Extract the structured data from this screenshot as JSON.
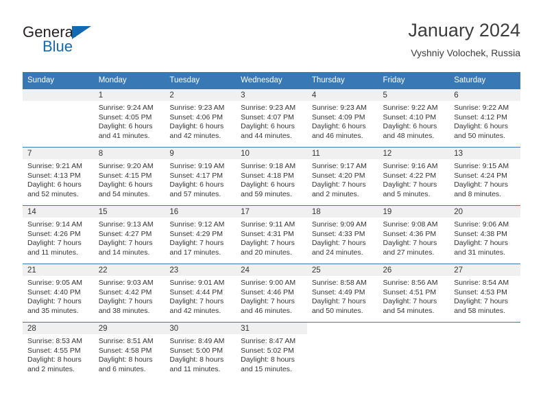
{
  "brand": {
    "name_part1": "General",
    "name_part2": "Blue",
    "accent_color": "#1268b3",
    "triangle_icon": "triangle-icon"
  },
  "header": {
    "title": "January 2024",
    "subtitle": "Vyshniy Volochek, Russia"
  },
  "calendar": {
    "header_bg": "#3878b4",
    "daynum_bg": "#f0f0f0",
    "weekday_headers": [
      "Sunday",
      "Monday",
      "Tuesday",
      "Wednesday",
      "Thursday",
      "Friday",
      "Saturday"
    ],
    "weeks": [
      [
        {
          "day": "",
          "empty": true,
          "sunrise": "",
          "sunset": "",
          "daylight_line1": "",
          "daylight_line2": ""
        },
        {
          "day": "1",
          "sunrise": "Sunrise: 9:24 AM",
          "sunset": "Sunset: 4:05 PM",
          "daylight_line1": "Daylight: 6 hours",
          "daylight_line2": "and 41 minutes."
        },
        {
          "day": "2",
          "sunrise": "Sunrise: 9:23 AM",
          "sunset": "Sunset: 4:06 PM",
          "daylight_line1": "Daylight: 6 hours",
          "daylight_line2": "and 42 minutes."
        },
        {
          "day": "3",
          "sunrise": "Sunrise: 9:23 AM",
          "sunset": "Sunset: 4:07 PM",
          "daylight_line1": "Daylight: 6 hours",
          "daylight_line2": "and 44 minutes."
        },
        {
          "day": "4",
          "sunrise": "Sunrise: 9:23 AM",
          "sunset": "Sunset: 4:09 PM",
          "daylight_line1": "Daylight: 6 hours",
          "daylight_line2": "and 46 minutes."
        },
        {
          "day": "5",
          "sunrise": "Sunrise: 9:22 AM",
          "sunset": "Sunset: 4:10 PM",
          "daylight_line1": "Daylight: 6 hours",
          "daylight_line2": "and 48 minutes."
        },
        {
          "day": "6",
          "sunrise": "Sunrise: 9:22 AM",
          "sunset": "Sunset: 4:12 PM",
          "daylight_line1": "Daylight: 6 hours",
          "daylight_line2": "and 50 minutes."
        }
      ],
      [
        {
          "day": "7",
          "sunrise": "Sunrise: 9:21 AM",
          "sunset": "Sunset: 4:13 PM",
          "daylight_line1": "Daylight: 6 hours",
          "daylight_line2": "and 52 minutes."
        },
        {
          "day": "8",
          "sunrise": "Sunrise: 9:20 AM",
          "sunset": "Sunset: 4:15 PM",
          "daylight_line1": "Daylight: 6 hours",
          "daylight_line2": "and 54 minutes."
        },
        {
          "day": "9",
          "sunrise": "Sunrise: 9:19 AM",
          "sunset": "Sunset: 4:17 PM",
          "daylight_line1": "Daylight: 6 hours",
          "daylight_line2": "and 57 minutes."
        },
        {
          "day": "10",
          "sunrise": "Sunrise: 9:18 AM",
          "sunset": "Sunset: 4:18 PM",
          "daylight_line1": "Daylight: 6 hours",
          "daylight_line2": "and 59 minutes."
        },
        {
          "day": "11",
          "sunrise": "Sunrise: 9:17 AM",
          "sunset": "Sunset: 4:20 PM",
          "daylight_line1": "Daylight: 7 hours",
          "daylight_line2": "and 2 minutes."
        },
        {
          "day": "12",
          "sunrise": "Sunrise: 9:16 AM",
          "sunset": "Sunset: 4:22 PM",
          "daylight_line1": "Daylight: 7 hours",
          "daylight_line2": "and 5 minutes."
        },
        {
          "day": "13",
          "sunrise": "Sunrise: 9:15 AM",
          "sunset": "Sunset: 4:24 PM",
          "daylight_line1": "Daylight: 7 hours",
          "daylight_line2": "and 8 minutes."
        }
      ],
      [
        {
          "day": "14",
          "sunrise": "Sunrise: 9:14 AM",
          "sunset": "Sunset: 4:26 PM",
          "daylight_line1": "Daylight: 7 hours",
          "daylight_line2": "and 11 minutes."
        },
        {
          "day": "15",
          "sunrise": "Sunrise: 9:13 AM",
          "sunset": "Sunset: 4:27 PM",
          "daylight_line1": "Daylight: 7 hours",
          "daylight_line2": "and 14 minutes."
        },
        {
          "day": "16",
          "sunrise": "Sunrise: 9:12 AM",
          "sunset": "Sunset: 4:29 PM",
          "daylight_line1": "Daylight: 7 hours",
          "daylight_line2": "and 17 minutes."
        },
        {
          "day": "17",
          "sunrise": "Sunrise: 9:11 AM",
          "sunset": "Sunset: 4:31 PM",
          "daylight_line1": "Daylight: 7 hours",
          "daylight_line2": "and 20 minutes."
        },
        {
          "day": "18",
          "sunrise": "Sunrise: 9:09 AM",
          "sunset": "Sunset: 4:33 PM",
          "daylight_line1": "Daylight: 7 hours",
          "daylight_line2": "and 24 minutes."
        },
        {
          "day": "19",
          "sunrise": "Sunrise: 9:08 AM",
          "sunset": "Sunset: 4:36 PM",
          "daylight_line1": "Daylight: 7 hours",
          "daylight_line2": "and 27 minutes."
        },
        {
          "day": "20",
          "sunrise": "Sunrise: 9:06 AM",
          "sunset": "Sunset: 4:38 PM",
          "daylight_line1": "Daylight: 7 hours",
          "daylight_line2": "and 31 minutes."
        }
      ],
      [
        {
          "day": "21",
          "sunrise": "Sunrise: 9:05 AM",
          "sunset": "Sunset: 4:40 PM",
          "daylight_line1": "Daylight: 7 hours",
          "daylight_line2": "and 35 minutes."
        },
        {
          "day": "22",
          "sunrise": "Sunrise: 9:03 AM",
          "sunset": "Sunset: 4:42 PM",
          "daylight_line1": "Daylight: 7 hours",
          "daylight_line2": "and 38 minutes."
        },
        {
          "day": "23",
          "sunrise": "Sunrise: 9:01 AM",
          "sunset": "Sunset: 4:44 PM",
          "daylight_line1": "Daylight: 7 hours",
          "daylight_line2": "and 42 minutes."
        },
        {
          "day": "24",
          "sunrise": "Sunrise: 9:00 AM",
          "sunset": "Sunset: 4:46 PM",
          "daylight_line1": "Daylight: 7 hours",
          "daylight_line2": "and 46 minutes."
        },
        {
          "day": "25",
          "sunrise": "Sunrise: 8:58 AM",
          "sunset": "Sunset: 4:49 PM",
          "daylight_line1": "Daylight: 7 hours",
          "daylight_line2": "and 50 minutes."
        },
        {
          "day": "26",
          "sunrise": "Sunrise: 8:56 AM",
          "sunset": "Sunset: 4:51 PM",
          "daylight_line1": "Daylight: 7 hours",
          "daylight_line2": "and 54 minutes."
        },
        {
          "day": "27",
          "sunrise": "Sunrise: 8:54 AM",
          "sunset": "Sunset: 4:53 PM",
          "daylight_line1": "Daylight: 7 hours",
          "daylight_line2": "and 58 minutes."
        }
      ],
      [
        {
          "day": "28",
          "sunrise": "Sunrise: 8:53 AM",
          "sunset": "Sunset: 4:55 PM",
          "daylight_line1": "Daylight: 8 hours",
          "daylight_line2": "and 2 minutes."
        },
        {
          "day": "29",
          "sunrise": "Sunrise: 8:51 AM",
          "sunset": "Sunset: 4:58 PM",
          "daylight_line1": "Daylight: 8 hours",
          "daylight_line2": "and 6 minutes."
        },
        {
          "day": "30",
          "sunrise": "Sunrise: 8:49 AM",
          "sunset": "Sunset: 5:00 PM",
          "daylight_line1": "Daylight: 8 hours",
          "daylight_line2": "and 11 minutes."
        },
        {
          "day": "31",
          "sunrise": "Sunrise: 8:47 AM",
          "sunset": "Sunset: 5:02 PM",
          "daylight_line1": "Daylight: 8 hours",
          "daylight_line2": "and 15 minutes."
        },
        {
          "day": "",
          "empty": true,
          "blank": true,
          "sunrise": "",
          "sunset": "",
          "daylight_line1": "",
          "daylight_line2": ""
        },
        {
          "day": "",
          "empty": true,
          "blank": true,
          "sunrise": "",
          "sunset": "",
          "daylight_line1": "",
          "daylight_line2": ""
        },
        {
          "day": "",
          "empty": true,
          "blank": true,
          "sunrise": "",
          "sunset": "",
          "daylight_line1": "",
          "daylight_line2": ""
        }
      ]
    ]
  }
}
